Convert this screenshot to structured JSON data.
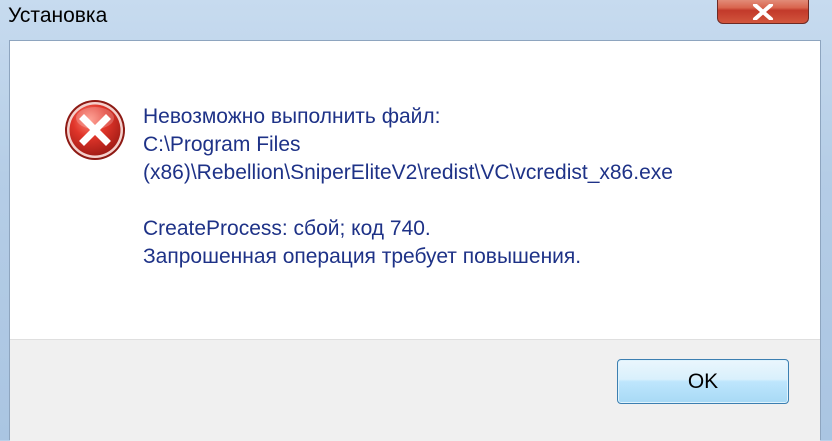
{
  "window": {
    "title": "Установка"
  },
  "titlebar": {
    "close_icon": "close-x-icon"
  },
  "dialog": {
    "icon": "error-icon",
    "message_lines": [
      "Невозможно выполнить файл:",
      "C:\\Program Files",
      "(x86)\\Rebellion\\SniperEliteV2\\redist\\VC\\vcredist_x86.exe"
    ],
    "error_lines": [
      "CreateProcess: сбой; код 740.",
      "Запрошенная операция требует повышения."
    ]
  },
  "buttons": {
    "ok_label": "OK"
  },
  "colors": {
    "message_text": "#1e3287",
    "error_red": "#d42a2a",
    "close_red": "#c2392a"
  }
}
